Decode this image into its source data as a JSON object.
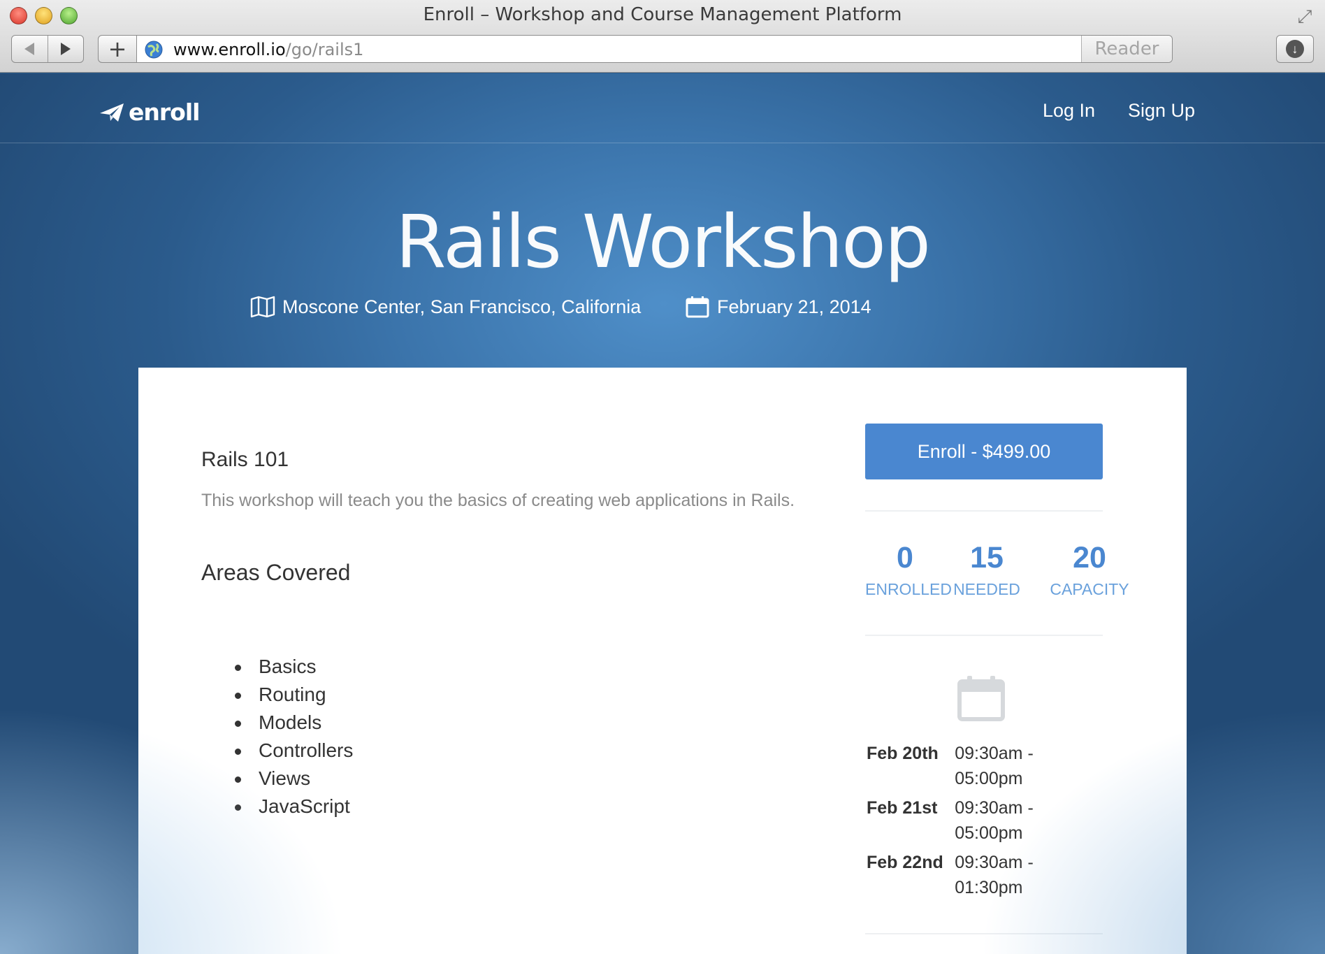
{
  "browser": {
    "window_title": "Enroll – Workshop and Course Management Platform",
    "url_host": "www.enroll.io",
    "url_path": "/go/rails1",
    "reader_label": "Reader",
    "plus_label": "+",
    "reload_label": "↻"
  },
  "nav": {
    "logo": "enroll",
    "login": "Log In",
    "signup": "Sign Up"
  },
  "hero": {
    "title": "Rails Workshop",
    "location": "Moscone Center, San Francisco, California",
    "date": "February 21, 2014"
  },
  "course": {
    "title": "Rails 101",
    "description": "This workshop will teach you the basics of creating web applications in Rails.",
    "areas_title": "Areas Covered",
    "areas": [
      "Basics",
      "Routing",
      "Models",
      "Controllers",
      "Views",
      "JavaScript"
    ]
  },
  "sidebar": {
    "enroll_button": "Enroll - $499.00",
    "stats": [
      {
        "value": "0",
        "label": "ENROLLED"
      },
      {
        "value": "15",
        "label": "NEEDED"
      },
      {
        "value": "20",
        "label": "CAPACITY"
      }
    ],
    "schedule": [
      {
        "day": "Feb 20th",
        "time": "09:30am - 05:00pm"
      },
      {
        "day": "Feb 21st",
        "time": "09:30am - 05:00pm"
      },
      {
        "day": "Feb 22nd",
        "time": "09:30am - 01:30pm"
      }
    ]
  },
  "icons": {
    "logo": "paper-plane-icon",
    "location": "map-icon",
    "date": "calendar-icon",
    "schedule": "calendar-icon"
  },
  "colors": {
    "accent": "#4a87d0",
    "stat_label": "#6aa1dc",
    "hero_bg": "#2b5b8c"
  }
}
